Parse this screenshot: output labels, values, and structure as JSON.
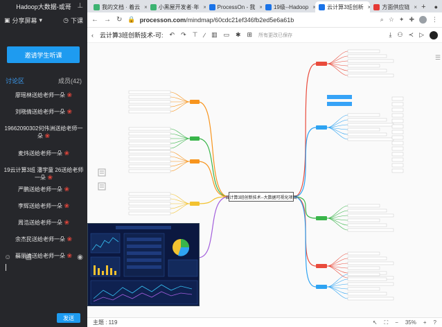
{
  "left": {
    "title": "Hadoop大数据-或哥",
    "share_label": "分享屏幕",
    "lower_label": "下课",
    "invite_label": "邀请学生听课",
    "tabs": {
      "discuss": "讨论区",
      "members": "成员(42)"
    },
    "messages": [
      "廖瑶林送给老师一朵",
      "刘晓倩送给老师一朵",
      "19662090302何伟洲送给老师一朵",
      "麦炜送给老师一朵",
      "19云计算3班 潘宇童 26送给老师一朵",
      "严鹏送给老师一朵",
      "李辉送给老师一朵",
      "周浩送给老师一朵",
      "余杰民送给老师一朵",
      "蔡丽清送给老师一朵"
    ],
    "flower_glyph": "❀",
    "send_label": "发送"
  },
  "browser": {
    "tabs": [
      {
        "label": "我的文档 · 着云",
        "color": "#3cb371"
      },
      {
        "label": "小黑屋开发者·年",
        "color": "#3cb371"
      },
      {
        "label": "ProcessOn - 我",
        "color": "#1a73e8"
      },
      {
        "label": "19级--Hadoop",
        "color": "#1a73e8"
      },
      {
        "label": "云计算3班创新",
        "color": "#1a73e8"
      },
      {
        "label": "方面供应链",
        "color": "#e53935"
      }
    ],
    "url_host": "processon.com",
    "url_path": "/mindmap/60cdc21ef346fb2ed5e6a61b",
    "doc_title": "云计算3班创新技术-可:",
    "saved_text": "所有更改已保存",
    "status_left": "主题 : 119",
    "zoom": "35%"
  },
  "mindmap": {
    "central": "云计算3班创新技术--大数据可视化项目",
    "branch_colors": {
      "orange": "#f7941d",
      "yellow": "#f2c230",
      "green": "#39b54a",
      "purple": "#a25ddc",
      "red": "#e94b3c",
      "blue": "#2ea3f2"
    }
  }
}
